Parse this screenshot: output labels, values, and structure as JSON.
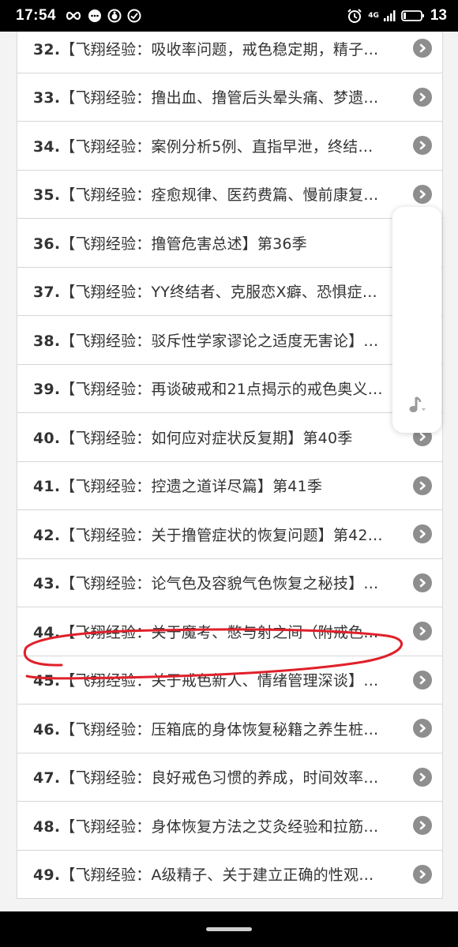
{
  "status_bar": {
    "time": "17:54",
    "network": "4G",
    "battery": "13",
    "icons": [
      "infinity-icon",
      "chat-bubble-icon",
      "app-circle-icon",
      "check-circle-icon",
      "alarm-icon",
      "signal-icon",
      "battery-icon"
    ]
  },
  "list": {
    "items": [
      {
        "num": "32.",
        "label": "【飞翔经验：吸收率问题，戒色稳定期，精子…"
      },
      {
        "num": "33.",
        "label": "【飞翔经验：撸出血、撸管后头晕头痛、梦遗…"
      },
      {
        "num": "34.",
        "label": "【飞翔经验：案例分析5例、直指早泄，终结…"
      },
      {
        "num": "35.",
        "label": "【飞翔经验：痊愈规律、医药费篇、慢前康复…"
      },
      {
        "num": "36.",
        "label": "【飞翔经验：撸管危害总述】第36季"
      },
      {
        "num": "37.",
        "label": "【飞翔经验：YY终结者、克服恋X癖、恐惧症…"
      },
      {
        "num": "38.",
        "label": "【飞翔经验：驳斥性学家谬论之适度无害论】…"
      },
      {
        "num": "39.",
        "label": "【飞翔经验：再谈破戒和21点揭示的戒色奥义…"
      },
      {
        "num": "40.",
        "label": "【飞翔经验：如何应对症状反复期】第40季"
      },
      {
        "num": "41.",
        "label": "【飞翔经验：控遗之道详尽篇】第41季"
      },
      {
        "num": "42.",
        "label": "【飞翔经验：关于撸管症状的恢复问题】第42…"
      },
      {
        "num": "43.",
        "label": "【飞翔经验：论气色及容貌气色恢复之秘技】…"
      },
      {
        "num": "44.",
        "label": "【飞翔经验：关于魔考、憋与射之间（附戒色…"
      },
      {
        "num": "45.",
        "label": "【飞翔经验：关于戒色新人、情绪管理深谈】…"
      },
      {
        "num": "46.",
        "label": "【飞翔经验：压箱底的身体恢复秘籍之养生桩…"
      },
      {
        "num": "47.",
        "label": "【飞翔经验：良好戒色习惯的养成，时间效率…"
      },
      {
        "num": "48.",
        "label": "【飞翔经验：身体恢复方法之艾灸经验和拉筋…"
      },
      {
        "num": "49.",
        "label": "【飞翔经验：A级精子、关于建立正确的性观…"
      }
    ]
  },
  "floating_panel": {
    "icon": "music-note-icon"
  },
  "annotation": {
    "color": "#e0202a",
    "highlighted_item": "44."
  },
  "colors": {
    "chevron": "#8e8e8e",
    "text": "#333333",
    "divider": "#d6d6d6"
  }
}
